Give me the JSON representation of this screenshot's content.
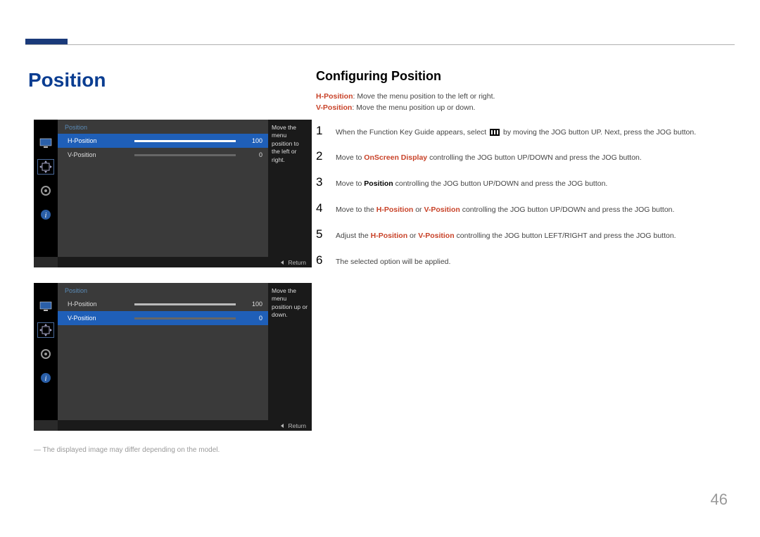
{
  "page": {
    "title": "Position",
    "section_title": "Configuring Position",
    "page_number": "46",
    "footnote": "The displayed image may differ depending on the model."
  },
  "descriptions": {
    "hpos_label": "H-Position",
    "hpos_text": ": Move the menu position to the left or right.",
    "vpos_label": "V-Position",
    "vpos_text": ": Move the menu position up or down."
  },
  "osd1": {
    "title": "Position",
    "rows": [
      {
        "label": "H-Position",
        "value": "100",
        "fill": 100,
        "selected": true
      },
      {
        "label": "V-Position",
        "value": "0",
        "fill": 0,
        "selected": false
      }
    ],
    "hint": "Move the menu position to the left or right.",
    "return_label": "Return"
  },
  "osd2": {
    "title": "Position",
    "rows": [
      {
        "label": "H-Position",
        "value": "100",
        "fill": 100,
        "selected": false
      },
      {
        "label": "V-Position",
        "value": "0",
        "fill": 0,
        "selected": true
      }
    ],
    "hint": "Move the menu position up or down.",
    "return_label": "Return"
  },
  "steps": [
    {
      "num": "1",
      "text_a": "When the Function Key Guide appears, select ",
      "text_b": " by moving the JOG button UP. Next, press the JOG button."
    },
    {
      "num": "2",
      "text_a": "Move to ",
      "red": "OnScreen Display",
      "text_b": " controlling the JOG button UP/DOWN and press the JOG button."
    },
    {
      "num": "3",
      "text_a": "Move to ",
      "blk": "Position",
      "text_b": " controlling the JOG button UP/DOWN and press the JOG button."
    },
    {
      "num": "4",
      "text_a": "Move to the ",
      "red1": "H-Position",
      "mid": " or ",
      "red2": "V-Position",
      "text_b": " controlling the JOG button UP/DOWN and press the JOG button."
    },
    {
      "num": "5",
      "text_a": "Adjust the ",
      "red1": "H-Position",
      "mid": " or ",
      "red2": "V-Position",
      "text_b": " controlling the JOG button LEFT/RIGHT and press the JOG button."
    },
    {
      "num": "6",
      "text_a": "The selected option will be applied."
    }
  ]
}
